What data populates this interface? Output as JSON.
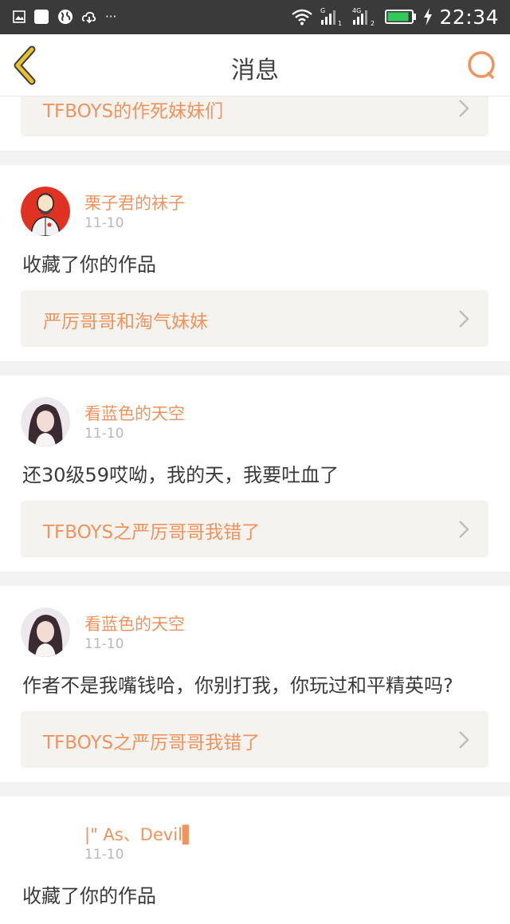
{
  "status_bar": {
    "time": "22:34",
    "more_indicator": "···",
    "network_labels": [
      "G",
      "4G"
    ],
    "sim_numbers": [
      "1",
      "2"
    ],
    "left_icons": [
      "image-icon",
      "white-square-icon",
      "globe-icon",
      "cloud-sync-icon"
    ],
    "right_icons": [
      "wifi-icon",
      "signal-sim1-icon",
      "signal-sim2-icon",
      "battery-icon",
      "charging-bolt-icon"
    ]
  },
  "header": {
    "title": "消息",
    "back_icon": "chevron-left-icon",
    "search_icon": "search-icon"
  },
  "colors": {
    "accent": "#f0935c",
    "back_yellow": "#e8c22e",
    "link_bg": "#f4f3ef",
    "status_bar": "#3a3a3a"
  },
  "items": [
    {
      "work_title": "TFBOYS的作死妹妹们"
    },
    {
      "username": "栗子君的袜子",
      "date": "11-10",
      "message": "收藏了你的作品",
      "work_title": "严厉哥哥和淘气妹妹"
    },
    {
      "username": "看蓝色的天空",
      "date": "11-10",
      "message": "还30级59哎呦，我的天，我要吐血了",
      "work_title": "TFBOYS之严厉哥哥我错了"
    },
    {
      "username": "看蓝色的天空",
      "date": "11-10",
      "message": "作者不是我嘴钱哈，你别打我，你玩过和平精英吗?",
      "work_title": "TFBOYS之严厉哥哥我错了"
    },
    {
      "username": "|\" As、Devil▌",
      "date": "11-10",
      "message": "收藏了你的作品"
    }
  ]
}
